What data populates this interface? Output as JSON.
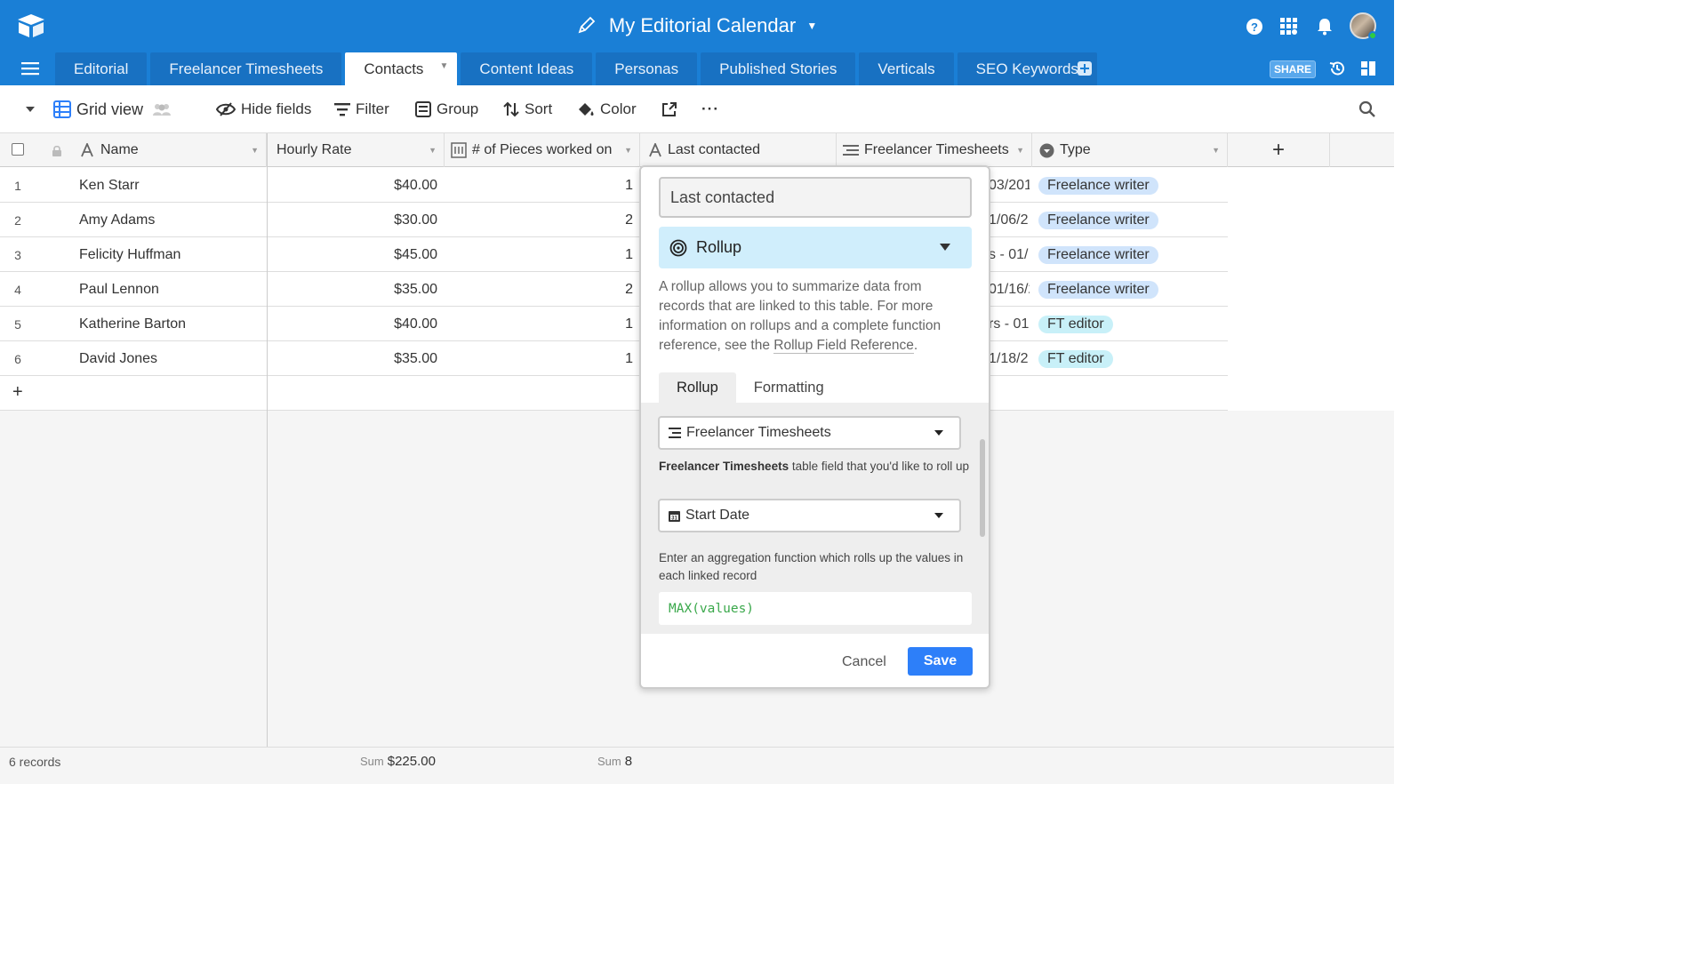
{
  "header": {
    "base_title": "My Editorial Calendar",
    "share_label": "SHARE",
    "tabs": [
      {
        "label": "Editorial"
      },
      {
        "label": "Freelancer Timesheets"
      },
      {
        "label": "Contacts"
      },
      {
        "label": "Content Ideas"
      },
      {
        "label": "Personas"
      },
      {
        "label": "Published Stories"
      },
      {
        "label": "Verticals"
      },
      {
        "label": "SEO Keywords"
      }
    ],
    "active_tab": "Contacts"
  },
  "toolbar": {
    "view_name": "Grid view",
    "hide_fields": "Hide fields",
    "filter": "Filter",
    "group": "Group",
    "sort": "Sort",
    "color": "Color",
    "more": "···"
  },
  "grid": {
    "columns": [
      {
        "label": "Name"
      },
      {
        "label": "Hourly Rate"
      },
      {
        "label": "# of Pieces worked on"
      },
      {
        "label": "Last contacted"
      },
      {
        "label": "Freelancer Timesheets"
      },
      {
        "label": "Type"
      }
    ],
    "rows": [
      {
        "num": "1",
        "name": "Ken Starr",
        "rate": "$40.00",
        "pieces": "1",
        "ts": "03/201",
        "type": "Freelance writer"
      },
      {
        "num": "2",
        "name": "Amy Adams",
        "rate": "$30.00",
        "pieces": "2",
        "ts": "1/06/2",
        "type": "Freelance writer"
      },
      {
        "num": "3",
        "name": "Felicity Huffman",
        "rate": "$45.00",
        "pieces": "1",
        "ts": "s - 01/",
        "type": "Freelance writer"
      },
      {
        "num": "4",
        "name": "Paul Lennon",
        "rate": "$35.00",
        "pieces": "2",
        "ts": "01/16/2",
        "type": "Freelance writer"
      },
      {
        "num": "5",
        "name": "Katherine Barton",
        "rate": "$40.00",
        "pieces": "1",
        "ts": "rs - 01",
        "type": "FT editor"
      },
      {
        "num": "6",
        "name": "David Jones",
        "rate": "$35.00",
        "pieces": "1",
        "ts": "1/18/2",
        "type": "FT editor"
      }
    ],
    "add_row": "+",
    "add_column": "+"
  },
  "footer": {
    "record_count": "6 records",
    "sum_label": "Sum",
    "rate_sum": "$225.00",
    "pieces_sum": "8"
  },
  "popup": {
    "field_name": "Last contacted",
    "field_type": "Rollup",
    "description_1": "A rollup allows you to summarize data from records that are linked to this table. For more information on rollups and a complete function reference, see the ",
    "description_link": "Rollup Field Reference",
    "description_end": ".",
    "tabs": [
      {
        "label": "Rollup"
      },
      {
        "label": "Formatting"
      }
    ],
    "linked_table": "Freelancer Timesheets",
    "hint_table_bold": "Freelancer Timesheets",
    "hint_table_rest": " table field that you'd like to roll up",
    "rollup_field": "Start Date",
    "hint_func": "Enter an aggregation function which rolls up the values in each linked record",
    "formula": "MAX(values)",
    "cancel": "Cancel",
    "save": "Save"
  },
  "colors": {
    "header_bg": "#1a7fd6",
    "tab_bg": "#1871c2",
    "rollup_bg": "#d0eefc",
    "save_bg": "#2d7ff9",
    "pill_writer": "#d0e4fb",
    "pill_editor": "#c8f0f8"
  },
  "icons": [
    "logo-icon",
    "pencil-icon",
    "help-icon",
    "apps-icon",
    "bell-icon",
    "menu-icon",
    "add-table-icon",
    "history-icon",
    "panel-icon",
    "grid-view-icon",
    "collaborators-icon",
    "hide-fields-icon",
    "filter-icon",
    "group-icon",
    "sort-icon",
    "color-icon",
    "share-view-icon",
    "search-icon",
    "rollup-icon",
    "link-icon",
    "date-icon"
  ]
}
